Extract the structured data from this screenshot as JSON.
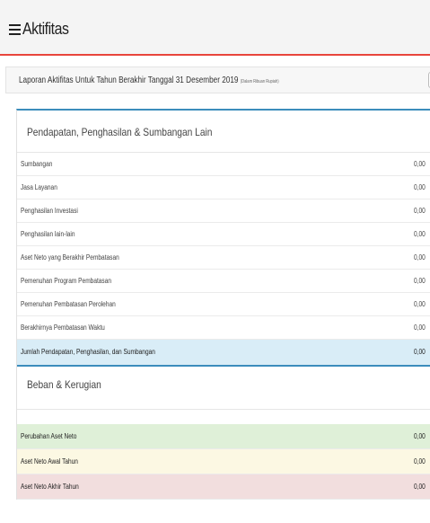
{
  "header": {
    "title": "Aktifitas"
  },
  "report": {
    "title": "Laporan Aktifitas Untuk Tahun Berakhir Tanggal 31 Desember 2019",
    "subtitle": "(Dalam Ribuan Rupiah)",
    "button_label": "≡"
  },
  "pendapatan": {
    "heading": "Pendapatan, Penghasilan & Sumbangan Lain",
    "rows": [
      {
        "label": "Sumbangan",
        "value": "0,00"
      },
      {
        "label": "Jasa Layanan",
        "value": "0,00"
      },
      {
        "label": "Penghasilan Investasi",
        "value": "0,00"
      },
      {
        "label": "Penghasilan lain-lain",
        "value": "0,00"
      },
      {
        "label": "Aset Neto yang Berakhir Pembatasan",
        "value": "0,00"
      },
      {
        "label": "Pemenuhan Program Pembatasan",
        "value": "0,00"
      },
      {
        "label": "Pemenuhan Pembatasan Perolehan",
        "value": "0,00"
      },
      {
        "label": "Berakhirnya Pembatasan Waktu",
        "value": "0,00"
      }
    ],
    "total": {
      "label": "Jumlah Pendapatan, Penghasilan, dan Sumbangan",
      "value": "0,00"
    }
  },
  "beban": {
    "heading": "Beban & Kerugian"
  },
  "summary": {
    "perubahan": {
      "label": "Perubahan Aset Neto",
      "value": "0,00"
    },
    "awal": {
      "label": "Aset Neto Awal Tahun",
      "value": "0,00"
    },
    "akhir": {
      "label": "Aset Neto Akhir Tahun",
      "value": "0,00"
    }
  }
}
